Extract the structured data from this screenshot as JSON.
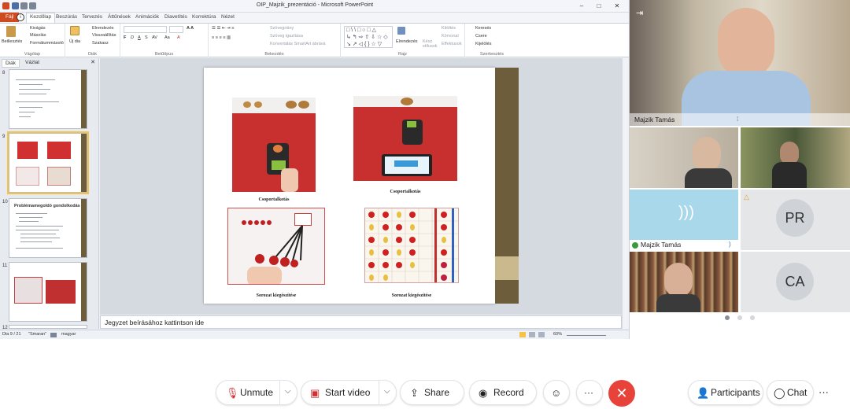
{
  "ppt": {
    "title": "OIP_Majzik_prezentáció  -  Microsoft PowerPoint",
    "tabs": [
      "Fájl",
      "Kezdőlap",
      "Beszúrás",
      "Tervezés",
      "Áttűnések",
      "Animációk",
      "Diavetítés",
      "Korrektúra",
      "Nézet"
    ],
    "active_tab_index": 1,
    "ribbon": {
      "clipboard": {
        "label": "Vágólap",
        "paste": "Beillesztés",
        "cut": "Kivágás",
        "copy": "Másolás",
        "format_painter": "Formátummásoló"
      },
      "slides": {
        "label": "Diák",
        "new_slide": "Új dia",
        "layout": "Elrendezés",
        "reset": "Visszaállítás",
        "section": "Szakasz"
      },
      "font": {
        "label": "Betűtípus"
      },
      "paragraph": {
        "label": "Bekezdés",
        "text_direction": "Szövegirány",
        "align_text": "Szöveg igazítása",
        "smartart": "Konvertálás SmartArt ábrává"
      },
      "drawing": {
        "label": "Rajz",
        "arrange": "Elrendezés",
        "quick_styles": "Kész stílusok",
        "fill": "Kitöltés",
        "outline": "Körvonal",
        "effects": "Effektusok"
      },
      "editing": {
        "label": "Szerkesztés",
        "find": "Keresés",
        "replace": "Csere",
        "select": "Kijelölés"
      }
    },
    "panel_tabs": [
      "Diák",
      "Vázlat"
    ],
    "thumbnails": [
      {
        "num": "8"
      },
      {
        "num": "9"
      },
      {
        "num": "10",
        "title": "Problémamegoldó gondolkodás"
      },
      {
        "num": "11"
      },
      {
        "num": "12"
      }
    ],
    "slide": {
      "captions": [
        "Csoportalkotás",
        "Csoportalkotás",
        "Sorozat kiegészítése",
        "Sorozat kiegészítése"
      ]
    },
    "notes_placeholder": "Jegyzet beírásához kattintson ide",
    "status": {
      "slide_of": "Dia 9 / 21",
      "theme": "\"Smaran\"",
      "language": "magyar",
      "zoom": "60%"
    }
  },
  "gallery": {
    "main_speaker": "Majzik Tamás",
    "audio_tile_name": "Majzik Tamás",
    "initials_1": "PR",
    "initials_2": "CA",
    "page_dots": 3,
    "active_page": 0
  },
  "toolbar": {
    "unmute": "Unmute",
    "start_video": "Start video",
    "share": "Share",
    "record": "Record",
    "more": "···",
    "participants": "Participants",
    "chat": "Chat"
  },
  "colors": {
    "leave_red": "#e8433a",
    "file_tab": "#d04a1f",
    "slide_accent": "#6e5d3a",
    "audio_tile": "#a8d8ea"
  }
}
